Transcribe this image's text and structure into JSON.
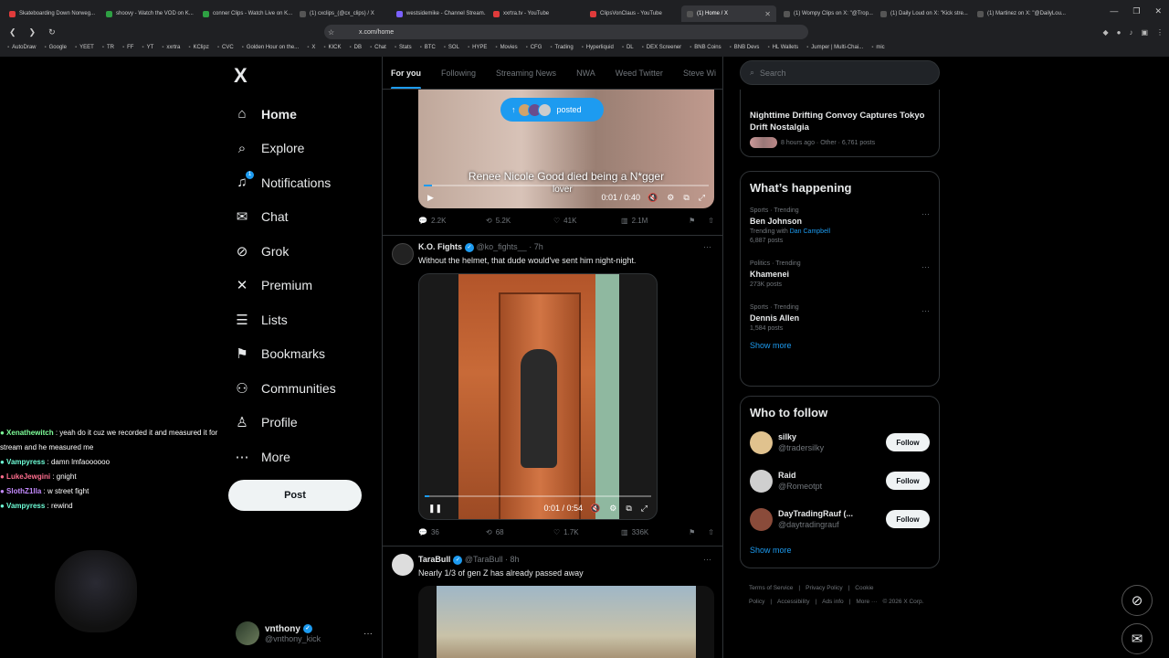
{
  "browser": {
    "tabs": [
      {
        "label": "Skateboarding Down Norweg...",
        "fav": "yt"
      },
      {
        "label": "shoovy - Watch the VOD on K...",
        "fav": "tw"
      },
      {
        "label": "conner Clips - Watch Live on K...",
        "fav": "tw"
      },
      {
        "label": "(1) cxclips_(@cx_clips) / X",
        "fav": "x"
      },
      {
        "label": "westsidemike - Channel Stream...",
        "fav": "tv"
      },
      {
        "label": "xxrtra.tv - YouTube",
        "fav": "yt"
      },
      {
        "label": "ClipsVonClaus - YouTube",
        "fav": "yt"
      },
      {
        "label": "(1) Home / X",
        "fav": "x"
      },
      {
        "label": "(1) Wompy Clips on X: \"@Trop...",
        "fav": "x"
      },
      {
        "label": "(1) Daily Loud on X: \"Kick stre...",
        "fav": "x"
      },
      {
        "label": "(1) Martinez on X: \"@DailyLou...",
        "fav": "x"
      }
    ],
    "active_tab_index": 7,
    "url": "x.com/home",
    "bookmarks": [
      "AutoDraw",
      "Google",
      "YEET",
      "TR",
      "FF",
      "YT",
      "xxrtra",
      "KClipz",
      "CVC",
      "Golden Hour on the...",
      "X",
      "KICK",
      "DB",
      "Chat",
      "Stats",
      "BTC",
      "SOL",
      "HYPE",
      "Movies",
      "CFG",
      "Trading",
      "Hyperliquid",
      "DL",
      "DEX Screener",
      "BNB Coins",
      "BNB Devs",
      "HL Wallets",
      "Jumper | Multi-Chai...",
      "mic"
    ]
  },
  "nav": {
    "logo": "X",
    "items": [
      {
        "label": "Home",
        "icon": "home-icon",
        "glyph": "⌂"
      },
      {
        "label": "Explore",
        "icon": "search-icon",
        "glyph": "⌕"
      },
      {
        "label": "Notifications",
        "icon": "bell-icon",
        "glyph": "♫",
        "badge": "1"
      },
      {
        "label": "Chat",
        "icon": "mail-icon",
        "glyph": "✉"
      },
      {
        "label": "Grok",
        "icon": "grok-icon",
        "glyph": "⊘"
      },
      {
        "label": "Premium",
        "icon": "x-icon",
        "glyph": "✕"
      },
      {
        "label": "Lists",
        "icon": "list-icon",
        "glyph": "☰"
      },
      {
        "label": "Bookmarks",
        "icon": "bookmark-icon",
        "glyph": "⚑"
      },
      {
        "label": "Communities",
        "icon": "communities-icon",
        "glyph": "⚇"
      },
      {
        "label": "Profile",
        "icon": "profile-icon",
        "glyph": "♙"
      },
      {
        "label": "More",
        "icon": "more-icon",
        "glyph": "⋯"
      }
    ],
    "post_label": "Post"
  },
  "account": {
    "name": "vnthony",
    "handle": "@vnthony_kick"
  },
  "chat_overlay": [
    {
      "user": "Xenathewitch",
      "msg": ": yeah do it cuz we recorded it and measured it for stream and he measured me",
      "color": "green"
    },
    {
      "user": "Vampyress",
      "msg": ": damn lmfaoooooo",
      "color": "teal"
    },
    {
      "user": "LukeJewgini",
      "msg": ": gnight",
      "color": "pink"
    },
    {
      "user": "SlothZ1lla",
      "msg": ": w street fight",
      "color": "purple"
    },
    {
      "user": "Vampyress",
      "msg": ": rewind",
      "color": "teal"
    }
  ],
  "feed": {
    "tabs": [
      "For you",
      "Following",
      "Streaming News",
      "NWA",
      "Weed Twitter",
      "Steve Wi"
    ],
    "posted_pill": "posted",
    "tweet1": {
      "caption": "Renee Nicole Good died being a N*gger",
      "caption2": "lover",
      "time": "0:01 / 0:40",
      "progress": 0.03,
      "stats": {
        "replies": "2.2K",
        "reposts": "5.2K",
        "likes": "41K",
        "views": "2.1M"
      }
    },
    "tweet2": {
      "name": "K.O. Fights",
      "handle": "@ko_fights__",
      "age": "· 7h",
      "text": "Without the helmet, that dude would've sent him night-night.",
      "time": "0:01 / 0:54",
      "progress": 0.02,
      "stats": {
        "replies": "36",
        "reposts": "68",
        "likes": "1.7K",
        "views": "336K"
      }
    },
    "tweet3": {
      "name": "TaraBull",
      "handle": "@TaraBull",
      "age": "· 8h",
      "text": "Nearly 1/3 of gen Z has already passed away"
    }
  },
  "sidebar": {
    "search_placeholder": "Search",
    "top_news": {
      "title": "Nighttime Drifting Convoy Captures Tokyo Drift Nostalgia",
      "meta": "8 hours ago · Other · 6,761 posts"
    },
    "happening_title": "What’s happening",
    "trends": [
      {
        "meta": "Sports · Trending",
        "title": "Ben Johnson",
        "sub_prefix": "Trending with",
        "sub_link": "Dan Campbell",
        "posts": "6,887 posts"
      },
      {
        "meta": "Politics · Trending",
        "title": "Khamenei",
        "posts": "273K posts"
      },
      {
        "meta": "Sports · Trending",
        "title": "Dennis Allen",
        "posts": "1,584 posts"
      }
    ],
    "show_more": "Show more",
    "follow_title": "Who to follow",
    "follows": [
      {
        "name": "silky",
        "handle": "@tradersilky",
        "color": "#e0c28e"
      },
      {
        "name": "Raid",
        "handle": "@Romeotpt",
        "color": "#cfcfcf"
      },
      {
        "name": "DayTradingRauf (...",
        "handle": "@daytradingrauf",
        "color": "#8a4b3a"
      }
    ],
    "follow_label": "Follow",
    "footer": [
      "Terms of Service",
      "|",
      "Privacy Policy",
      "|",
      "Cookie Policy",
      "|",
      "Accessibility",
      "|",
      "Ads info",
      "|",
      "More ···",
      "© 2026 X Corp."
    ]
  }
}
